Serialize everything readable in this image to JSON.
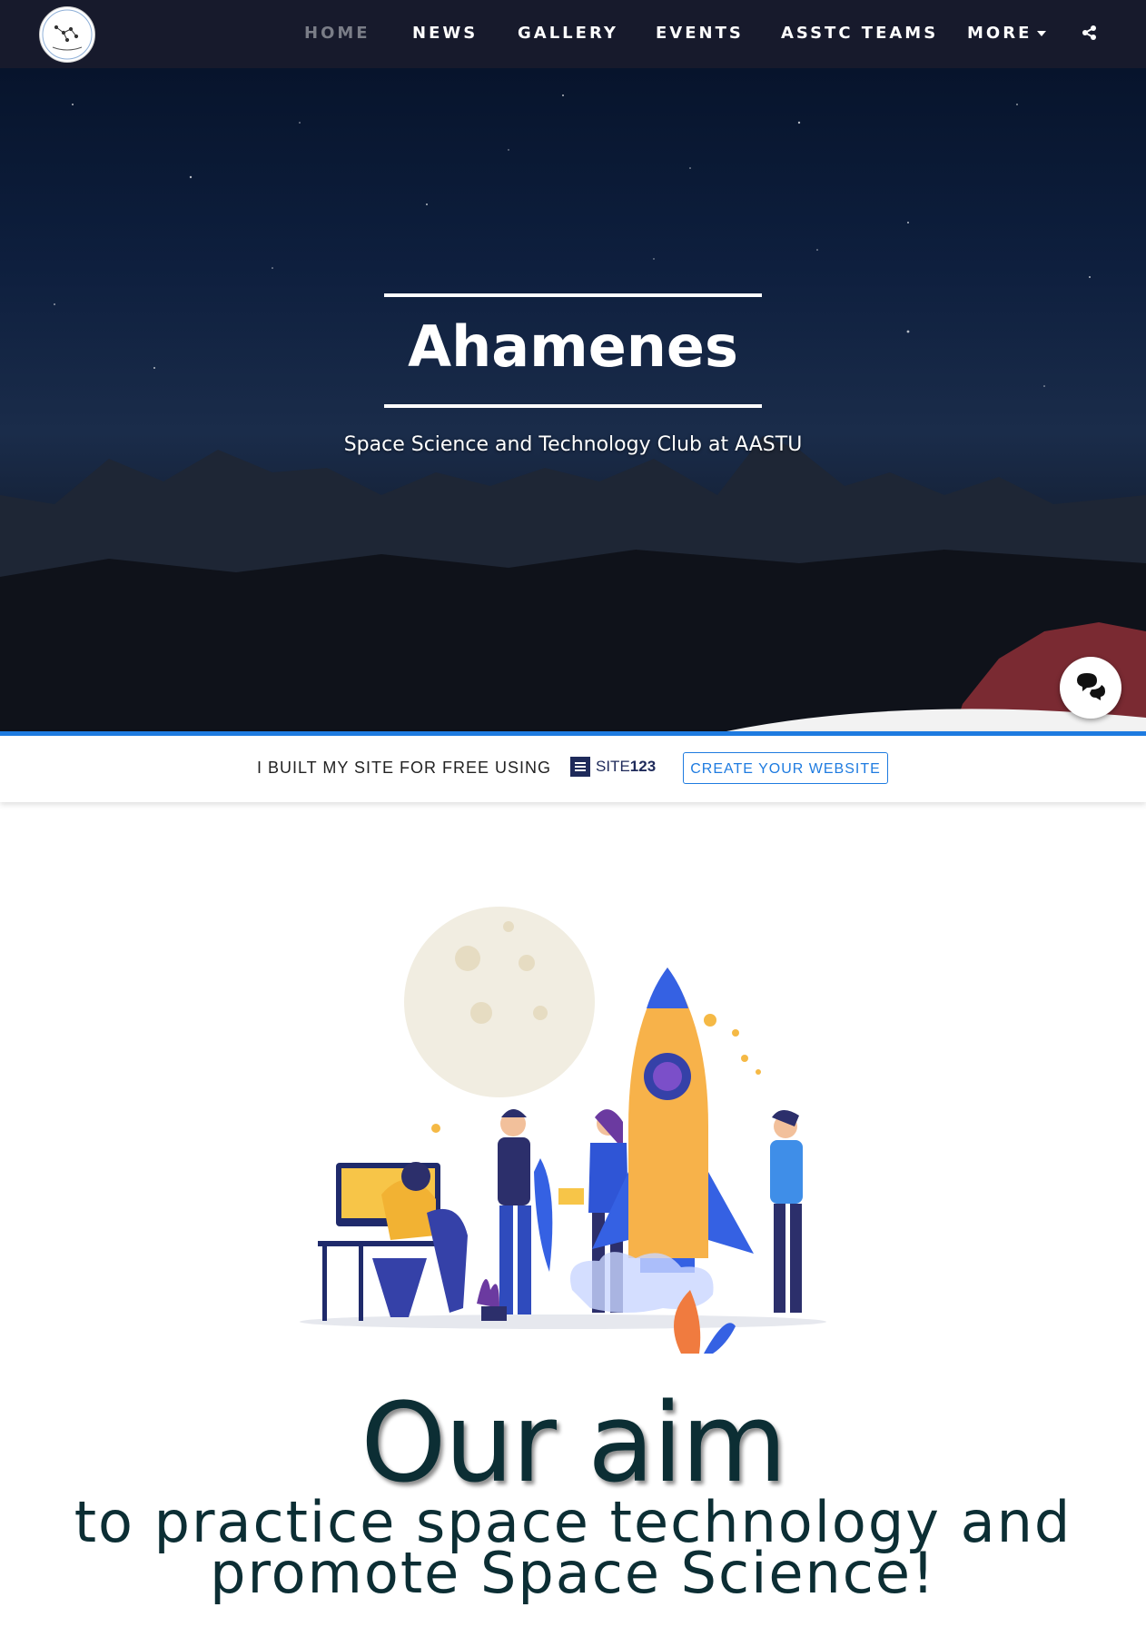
{
  "nav": {
    "logo_alt": "Ahamenes logo",
    "items": [
      {
        "label": "HOME",
        "active": true
      },
      {
        "label": "NEWS",
        "active": false
      },
      {
        "label": "GALLERY",
        "active": false
      },
      {
        "label": "EVENTS",
        "active": false
      },
      {
        "label": "ASSTC TEAMS",
        "active": false
      },
      {
        "label": "MORE",
        "active": false
      }
    ],
    "share_icon": "share-icon"
  },
  "hero": {
    "title": "Ahamenes",
    "subtitle": "Space Science and Technology Club at AASTU",
    "chat_icon": "chat-icon"
  },
  "promo": {
    "text": "I BUILT MY SITE FOR FREE USING",
    "brand_prefix": "SITE",
    "brand_number": "123",
    "button_label": "CREATE YOUR WEBSITE",
    "accent_color": "#1e7be0"
  },
  "aim": {
    "title": "Our aim",
    "text": "to practice space technology and promote Space Science!"
  },
  "colors": {
    "nav_bg": "#171a2c",
    "aim_text": "#0c2e34"
  }
}
